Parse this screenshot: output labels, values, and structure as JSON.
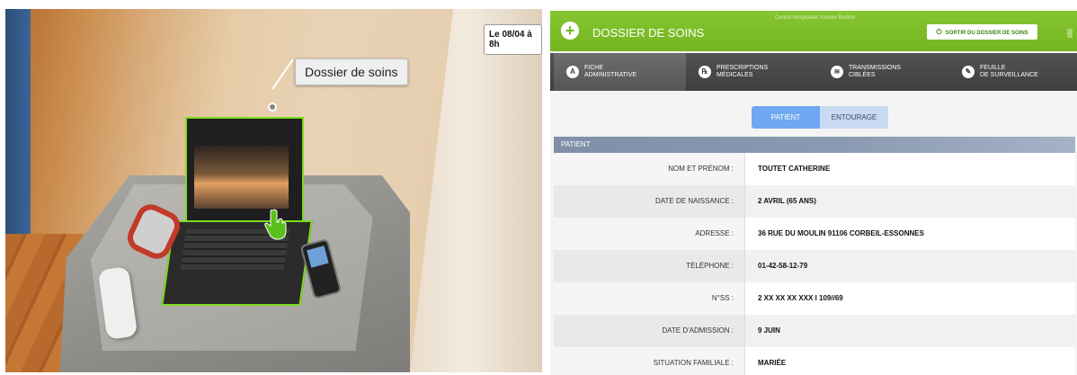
{
  "scene": {
    "date_badge": "Le 08/04 à 8h",
    "tooltip": "Dossier de soins"
  },
  "app": {
    "title": "DOSSIER DE SOINS",
    "hospital": "Centre Hospitalier Xxxxxx Bicêtre",
    "exit_label": "SORTIR DU DOSSIER DE SOINS",
    "colors": {
      "accent_green": "#74b520",
      "nav_dark": "#3e3e3e",
      "segment_active": "#6fa8f0"
    },
    "nav": [
      {
        "label": "FICHE\nADMINISTRATIVE",
        "icon": "person-icon",
        "glyph": "A"
      },
      {
        "label": "PRESCRIPTIONS\nMÉDICALES",
        "icon": "pill-icon",
        "glyph": "℞"
      },
      {
        "label": "TRANSMISSIONS\nCIBLÉES",
        "icon": "wifi-icon",
        "glyph": "≋"
      },
      {
        "label": "FEUILLE\nDE SURVEILLANCE",
        "icon": "edit-icon",
        "glyph": "✎"
      }
    ],
    "segment": {
      "active": "PATIENT",
      "inactive": "ENTOURAGE"
    },
    "section_title": "PATIENT",
    "rows": [
      {
        "label": "NOM ET PRÉNOM :",
        "value": "TOUTET CATHERINE"
      },
      {
        "label": "DATE DE NAISSANCE :",
        "value": "2 AVRIL (65 ANS)"
      },
      {
        "label": "ADRESSE :",
        "value": "36 RUE DU MOULIN 91106 CORBEIL-ESSONNES"
      },
      {
        "label": "TÉLÉPHONE :",
        "value": "01-42-58-12-79"
      },
      {
        "label": "N°SS :",
        "value": "2 XX XX XX XXX I 109//69"
      },
      {
        "label": "DATE D'ADMISSION :",
        "value": "9 JUIN"
      },
      {
        "label": "SITUATION FAMILIALE :",
        "value": "MARIÉE"
      }
    ]
  }
}
